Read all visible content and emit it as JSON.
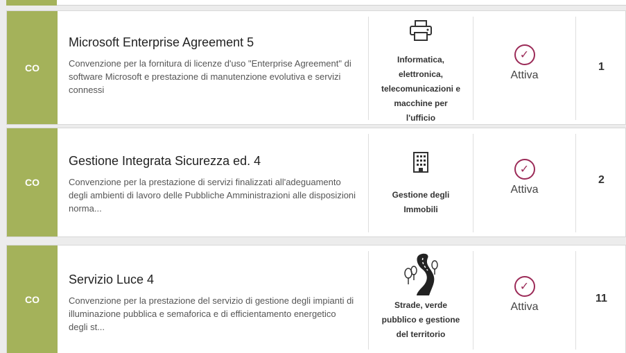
{
  "colors": {
    "tag": "#a4b25a",
    "status_accent": "#9b2a57"
  },
  "rows": [
    {
      "tag": "CO",
      "title": "Microsoft Enterprise Agreement 5",
      "description": "Convenzione per la fornitura di licenze d'uso \"Enterprise Agreement\" di software Microsoft e prestazione di manutenzione evolutiva e servizi connessi",
      "category_icon": "printer-icon",
      "category_lines": [
        "Informatica,",
        "elettronica,",
        "telecomunicazioni e",
        "macchine per",
        "l'ufficio"
      ],
      "status": "Attiva",
      "status_icon": "check-circle-icon",
      "count": "1"
    },
    {
      "tag": "CO",
      "title": "Gestione Integrata Sicurezza ed. 4",
      "description": "Convenzione per la prestazione di servizi finalizzati all'adeguamento degli ambienti di lavoro delle Pubbliche Amministrazioni alle disposizioni norma...",
      "category_icon": "building-icon",
      "category_lines": [
        "Gestione degli",
        "Immobili"
      ],
      "status": "Attiva",
      "status_icon": "check-circle-icon",
      "count": "2"
    },
    {
      "tag": "CO",
      "title": "Servizio Luce 4",
      "description": "Convenzione per la prestazione del servizio di gestione degli impianti di illuminazione pubblica e semaforica e di efficientamento energetico degli st...",
      "category_icon": "road-trees-icon",
      "category_lines": [
        "Strade, verde",
        "pubblico e gestione",
        "del territorio"
      ],
      "status": "Attiva",
      "status_icon": "check-circle-icon",
      "count": "11"
    }
  ]
}
